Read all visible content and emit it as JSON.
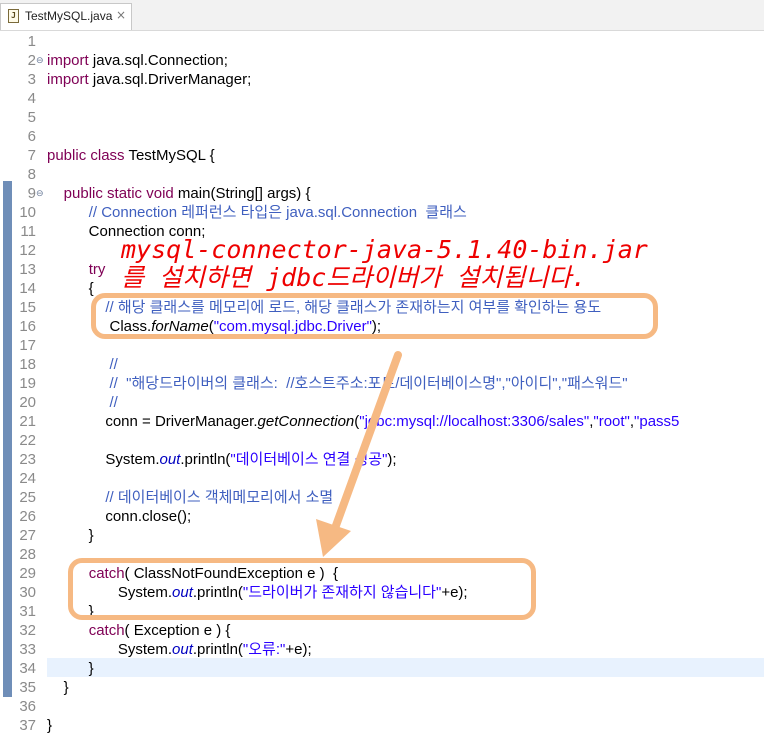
{
  "tab": {
    "filename": "TestMySQL.java",
    "close_glyph": "×",
    "file_icon": "java-file-icon",
    "file_icon_glyph": "J"
  },
  "lines": [
    {
      "n": "1",
      "fold": "",
      "segs": []
    },
    {
      "n": "2",
      "fold": "⊖",
      "segs": [
        {
          "t": "import",
          "c": "kw"
        },
        {
          "t": " java.sql.Connection;"
        }
      ]
    },
    {
      "n": "3",
      "fold": "",
      "segs": [
        {
          "t": "import",
          "c": "kw"
        },
        {
          "t": " java.sql.DriverManager;"
        }
      ]
    },
    {
      "n": "4",
      "fold": "",
      "segs": []
    },
    {
      "n": "5",
      "fold": "",
      "segs": []
    },
    {
      "n": "6",
      "fold": "",
      "segs": []
    },
    {
      "n": "7",
      "fold": "",
      "segs": [
        {
          "t": "public",
          "c": "kw"
        },
        {
          "t": " "
        },
        {
          "t": "class",
          "c": "kw"
        },
        {
          "t": " TestMySQL {"
        }
      ]
    },
    {
      "n": "8",
      "fold": "",
      "segs": []
    },
    {
      "n": "9",
      "fold": "⊖",
      "segs": [
        {
          "t": "    "
        },
        {
          "t": "public",
          "c": "kw"
        },
        {
          "t": " "
        },
        {
          "t": "static",
          "c": "kw"
        },
        {
          "t": " "
        },
        {
          "t": "void",
          "c": "kw"
        },
        {
          "t": " main(String[] args) {"
        }
      ]
    },
    {
      "n": "10",
      "fold": "",
      "segs": [
        {
          "t": "          "
        },
        {
          "t": "// Connection 레퍼런스 타입은 java.sql.Connection  클래스",
          "c": "cm"
        }
      ]
    },
    {
      "n": "11",
      "fold": "",
      "segs": [
        {
          "t": "          Connection conn;"
        }
      ]
    },
    {
      "n": "12",
      "fold": "",
      "segs": []
    },
    {
      "n": "13",
      "fold": "",
      "segs": [
        {
          "t": "          "
        },
        {
          "t": "try",
          "c": "kw"
        }
      ]
    },
    {
      "n": "14",
      "fold": "",
      "segs": [
        {
          "t": "          {"
        }
      ]
    },
    {
      "n": "15",
      "fold": "",
      "segs": [
        {
          "t": "              "
        },
        {
          "t": "// 해당 클래스를 메모리에 로드, 해당 클래스가 존재하는지 여부를 확인하는 용도",
          "c": "cm"
        }
      ]
    },
    {
      "n": "16",
      "fold": "",
      "segs": [
        {
          "t": "               Class."
        },
        {
          "t": "forName",
          "c": "it"
        },
        {
          "t": "("
        },
        {
          "t": "\"com.mysql.jdbc.Driver\"",
          "c": "st"
        },
        {
          "t": ");"
        }
      ]
    },
    {
      "n": "17",
      "fold": "",
      "segs": []
    },
    {
      "n": "18",
      "fold": "",
      "segs": [
        {
          "t": "               "
        },
        {
          "t": "//",
          "c": "cm"
        }
      ]
    },
    {
      "n": "19",
      "fold": "",
      "segs": [
        {
          "t": "               "
        },
        {
          "t": "//  \"해당드라이버의 클래스:  //호스트주소:포트/데이터베이스명\",\"아이디\",\"패스워드\"",
          "c": "cm"
        }
      ]
    },
    {
      "n": "20",
      "fold": "",
      "segs": [
        {
          "t": "               "
        },
        {
          "t": "//",
          "c": "cm"
        }
      ]
    },
    {
      "n": "21",
      "fold": "",
      "segs": [
        {
          "t": "              conn = DriverManager."
        },
        {
          "t": "getConnection",
          "c": "it"
        },
        {
          "t": "("
        },
        {
          "t": "\"jdbc:mysql://localhost:3306/sales\"",
          "c": "st"
        },
        {
          "t": ","
        },
        {
          "t": "\"root\"",
          "c": "st"
        },
        {
          "t": ","
        },
        {
          "t": "\"pass5",
          "c": "st"
        }
      ]
    },
    {
      "n": "22",
      "fold": "",
      "segs": []
    },
    {
      "n": "23",
      "fold": "",
      "segs": [
        {
          "t": "              System."
        },
        {
          "t": "out",
          "c": "fi"
        },
        {
          "t": ".println("
        },
        {
          "t": "\"데이터베이스 연결 성공\"",
          "c": "st"
        },
        {
          "t": ");"
        }
      ]
    },
    {
      "n": "24",
      "fold": "",
      "segs": []
    },
    {
      "n": "25",
      "fold": "",
      "segs": [
        {
          "t": "              "
        },
        {
          "t": "// 데이터베이스 객체메모리에서 소멸",
          "c": "cm"
        }
      ]
    },
    {
      "n": "26",
      "fold": "",
      "segs": [
        {
          "t": "              conn.close();"
        }
      ]
    },
    {
      "n": "27",
      "fold": "",
      "segs": [
        {
          "t": "          }"
        }
      ]
    },
    {
      "n": "28",
      "fold": "",
      "segs": []
    },
    {
      "n": "29",
      "fold": "",
      "segs": [
        {
          "t": "          "
        },
        {
          "t": "catch",
          "c": "kw"
        },
        {
          "t": "( ClassNotFoundException e )  {"
        }
      ]
    },
    {
      "n": "30",
      "fold": "",
      "segs": [
        {
          "t": "                 System."
        },
        {
          "t": "out",
          "c": "fi"
        },
        {
          "t": ".println("
        },
        {
          "t": "\"드라이버가 존재하지 않습니다\"",
          "c": "st"
        },
        {
          "t": "+e);"
        }
      ]
    },
    {
      "n": "31",
      "fold": "",
      "segs": [
        {
          "t": "          }"
        }
      ]
    },
    {
      "n": "32",
      "fold": "",
      "segs": [
        {
          "t": "          "
        },
        {
          "t": "catch",
          "c": "kw"
        },
        {
          "t": "( Exception e ) {"
        }
      ]
    },
    {
      "n": "33",
      "fold": "",
      "segs": [
        {
          "t": "                 System."
        },
        {
          "t": "out",
          "c": "fi"
        },
        {
          "t": ".println("
        },
        {
          "t": "\"오류:\"",
          "c": "st"
        },
        {
          "t": "+e);"
        }
      ]
    },
    {
      "n": "34",
      "fold": "",
      "segs": [
        {
          "t": "          }"
        }
      ]
    },
    {
      "n": "35",
      "fold": "",
      "segs": [
        {
          "t": "    }"
        }
      ]
    },
    {
      "n": "36",
      "fold": "",
      "segs": []
    },
    {
      "n": "37",
      "fold": "",
      "segs": [
        {
          "t": "}"
        }
      ]
    }
  ],
  "annotation": {
    "line1": "mysql-connector-java-5.1.40-bin.jar",
    "line2": "를 설치하면 jdbc드라이버가 설치됩니다."
  },
  "colors": {
    "keyword": "#7f0055",
    "comment": "#3f5fbf",
    "string": "#2a00ff",
    "annotation": "#ee0000",
    "highlight": "#f6b983",
    "ruler": "#6f8eb8"
  }
}
